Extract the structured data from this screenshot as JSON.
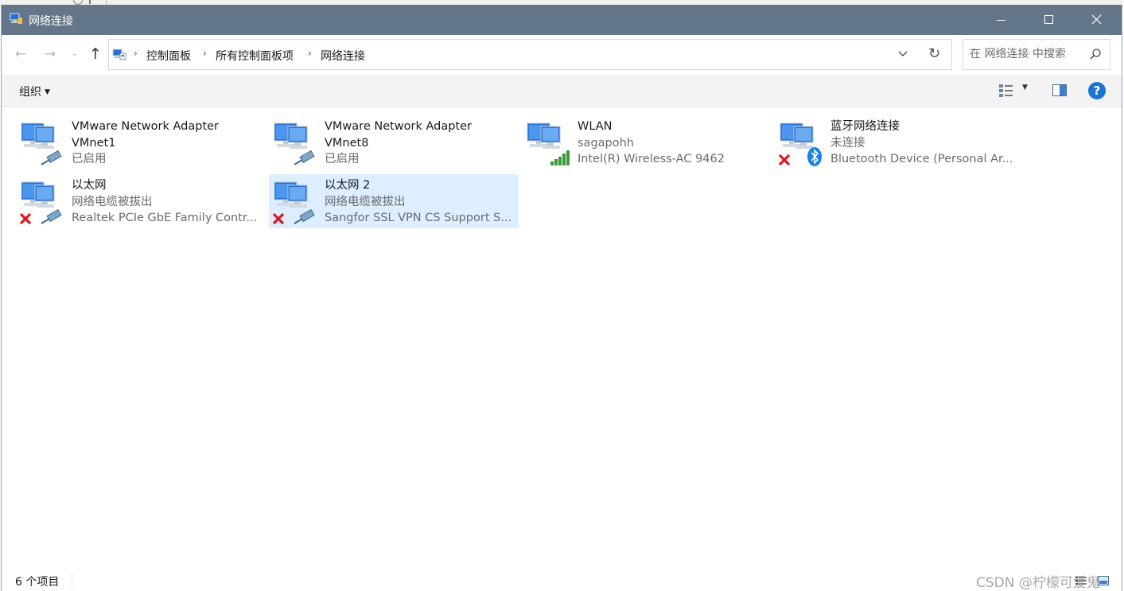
{
  "window": {
    "title": "网络连接"
  },
  "nav": {
    "breadcrumbs": [
      "控制面板",
      "所有控制面板项",
      "网络连接"
    ],
    "search_placeholder": "在 网络连接 中搜索"
  },
  "toolbar": {
    "organize_label": "组织",
    "help_label": "?"
  },
  "adapters": [
    {
      "name_line1": "VMware Network Adapter",
      "name_line2": "VMnet1",
      "status": "已启用",
      "device": "",
      "type": "ethernet",
      "disconnected": false,
      "selected": false
    },
    {
      "name_line1": "VMware Network Adapter",
      "name_line2": "VMnet8",
      "status": "已启用",
      "device": "",
      "type": "ethernet",
      "disconnected": false,
      "selected": false
    },
    {
      "name_line1": "WLAN",
      "name_line2": "",
      "status": "sagapohh",
      "device": "Intel(R) Wireless-AC 9462",
      "type": "wifi",
      "disconnected": false,
      "selected": false
    },
    {
      "name_line1": "蓝牙网络连接",
      "name_line2": "",
      "status": "未连接",
      "device": "Bluetooth Device (Personal Ar...",
      "type": "bluetooth",
      "disconnected": true,
      "selected": false
    },
    {
      "name_line1": "以太网",
      "name_line2": "",
      "status": "网络电缆被拔出",
      "device": "Realtek PCIe GbE Family Contr...",
      "type": "ethernet",
      "disconnected": true,
      "selected": false
    },
    {
      "name_line1": "以太网 2",
      "name_line2": "",
      "status": "网络电缆被拔出",
      "device": "Sangfor SSL VPN CS Support S...",
      "type": "ethernet",
      "disconnected": true,
      "selected": true
    }
  ],
  "status_bar": {
    "item_count": "6 个项目"
  },
  "watermark": "CSDN @柠檬可爱鬼",
  "colors": {
    "titlebar": "#64768a",
    "selection": "#dceeff",
    "help": "#1b75d0",
    "error": "#e0161c",
    "wifi_bars": "#3a9a3a"
  }
}
